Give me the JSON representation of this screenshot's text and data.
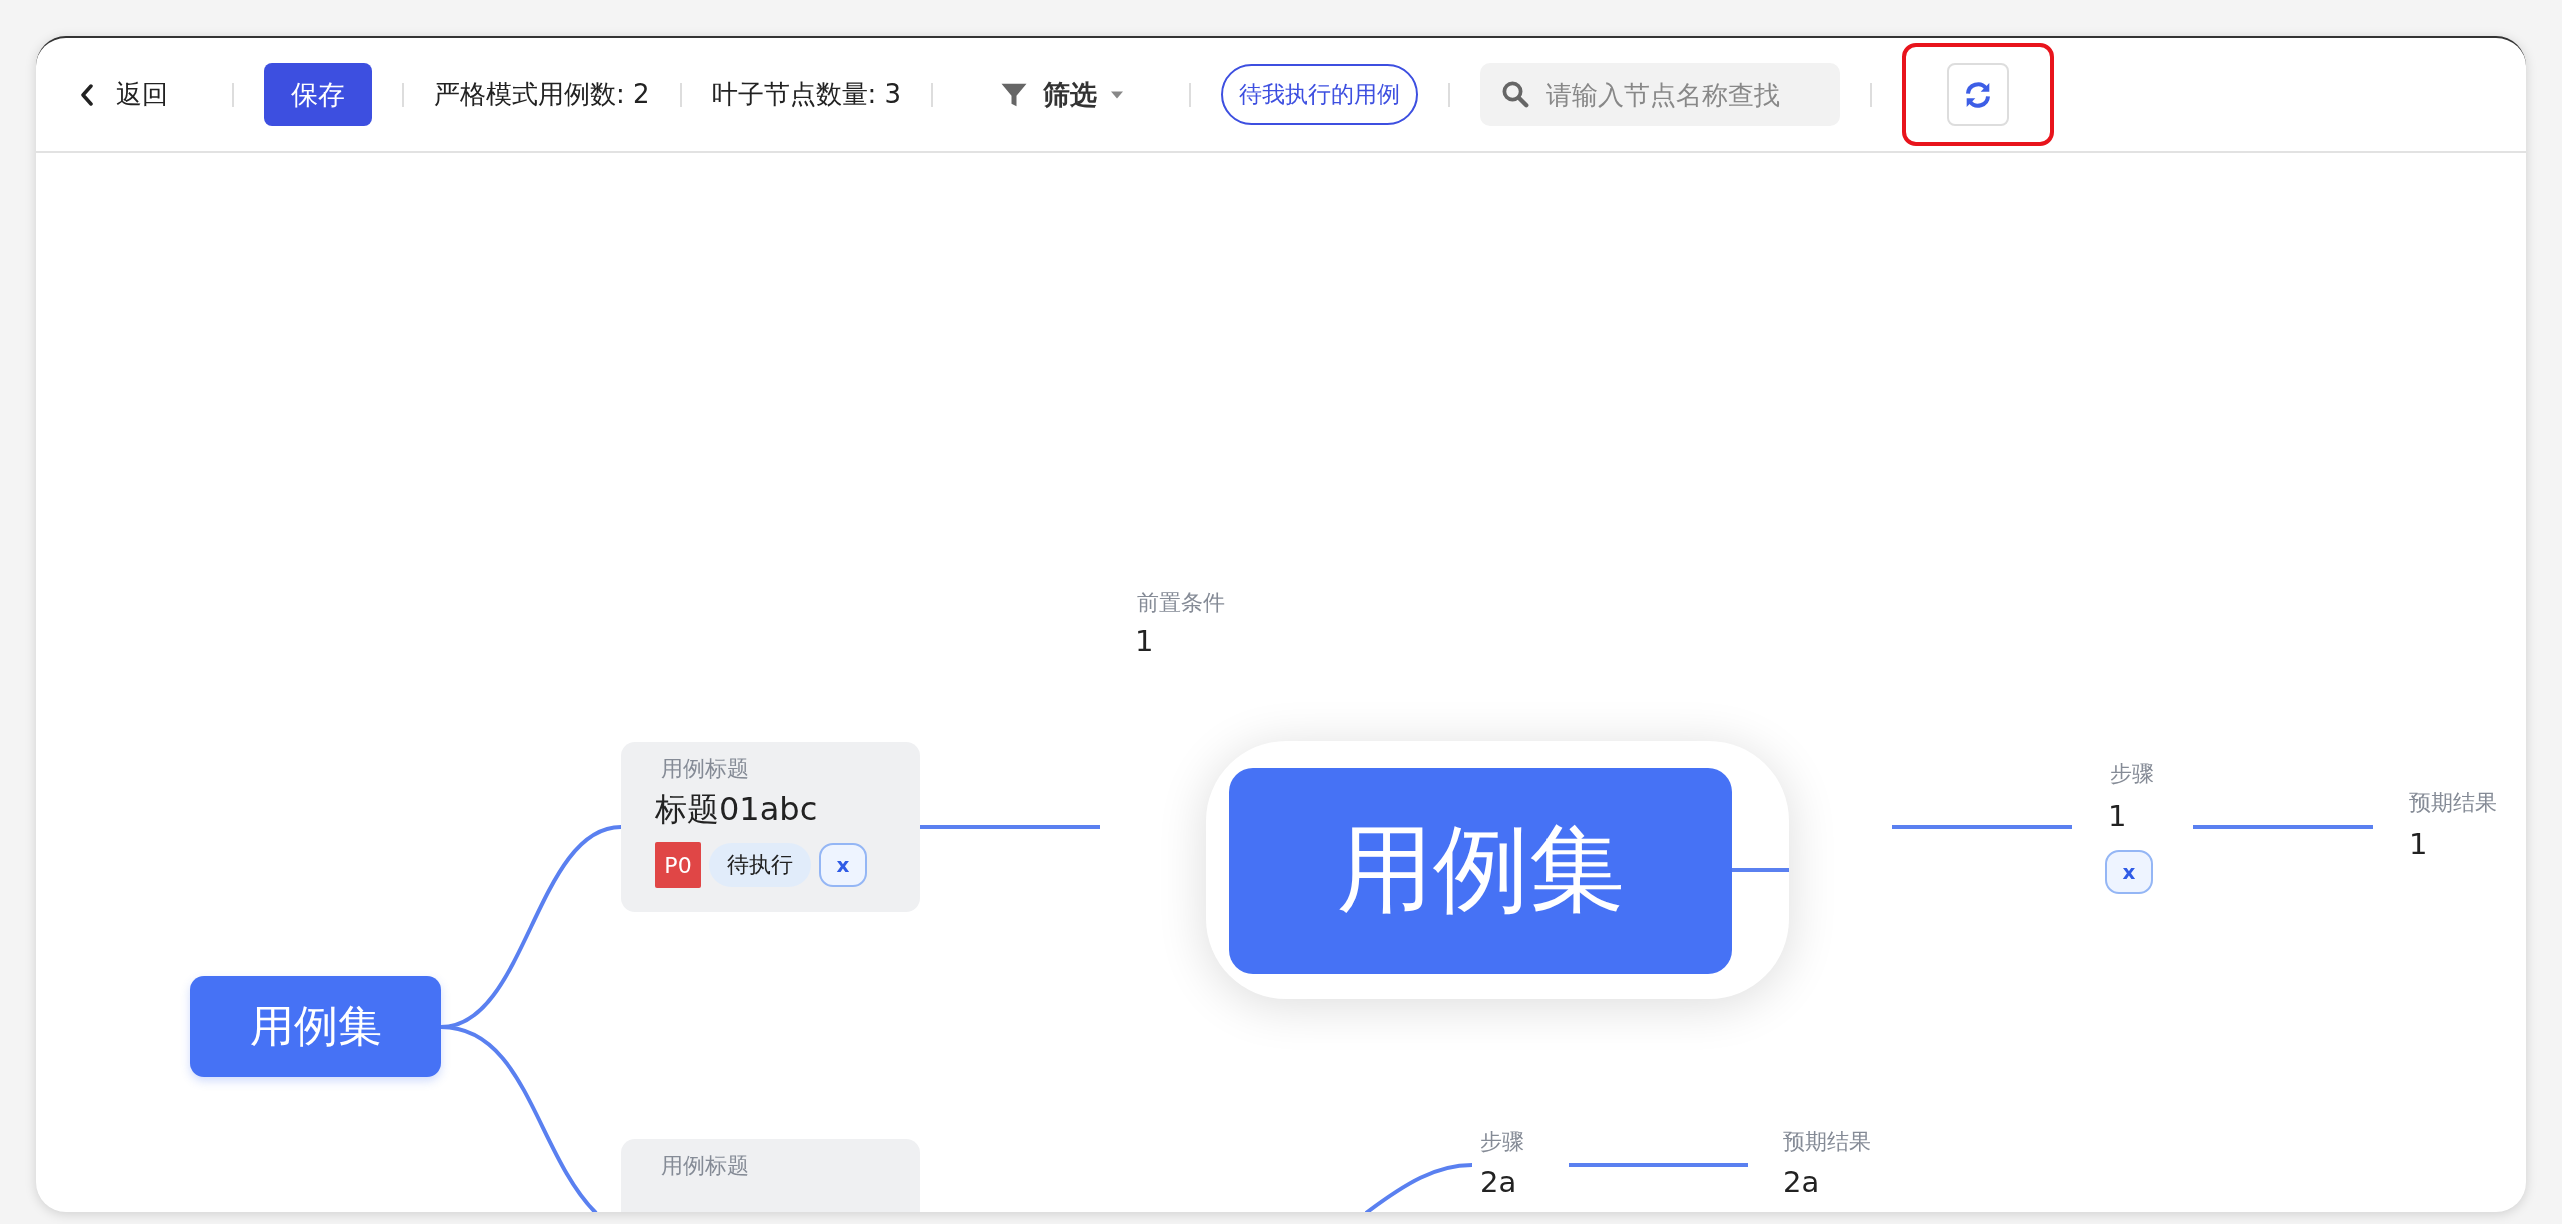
{
  "toolbar": {
    "back": "返回",
    "save": "保存",
    "strict_count": "严格模式用例数: 2",
    "leaf_count": "叶子节点数量: 3",
    "filter": "筛选",
    "my_cases": "待我执行的用例",
    "search": {
      "placeholder": "请输入节点名称查找"
    },
    "refresh_highlighted": true
  },
  "mindmap": {
    "root": "用例集",
    "cases": [
      {
        "label": "用例标题",
        "title": "标题01abc",
        "priority": "P0",
        "status": "待执行",
        "remove": "x"
      },
      {
        "label": "用例标题"
      }
    ],
    "precondition": {
      "label": "前置条件",
      "value": "1"
    },
    "focus_node": "用例集",
    "steps": [
      {
        "label": "步骤",
        "value": "1",
        "remove": "x",
        "expected": {
          "label": "预期结果",
          "value": "1"
        }
      },
      {
        "label": "步骤",
        "value": "2a",
        "expected": {
          "label": "预期结果",
          "value": "2a"
        }
      }
    ]
  }
}
